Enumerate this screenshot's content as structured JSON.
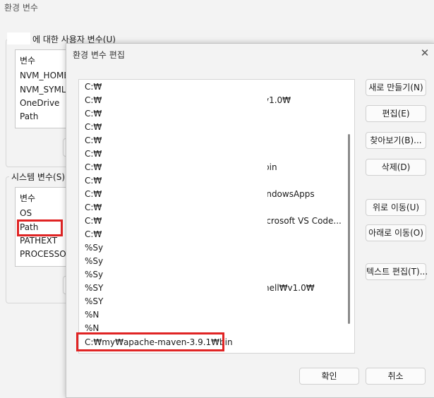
{
  "background_window": {
    "title": "환경 변수",
    "user_group": {
      "legend": "에 대한 사용자 변수(U)",
      "header": "변수",
      "items": [
        "NVM_HOME",
        "NVM_SYMLINK",
        "OneDrive",
        "Path"
      ]
    },
    "system_group": {
      "legend": "시스템 변수(S)",
      "header": "변수",
      "items": [
        "OS",
        "Path",
        "PATHEXT",
        "PROCESSOR"
      ]
    }
  },
  "dialog": {
    "title": "환경 변수 편집",
    "close_icon": "close-icon",
    "path_entries": [
      {
        "prefix": "C:₩",
        "tail": ""
      },
      {
        "prefix": "C:₩",
        "tail": "v1.0₩"
      },
      {
        "prefix": "C:₩",
        "tail": ""
      },
      {
        "prefix": "C:₩",
        "tail": ""
      },
      {
        "prefix": "C:₩",
        "tail": ""
      },
      {
        "prefix": "C:₩",
        "tail": ""
      },
      {
        "prefix": "C:₩",
        "tail": "pin"
      },
      {
        "prefix": "C:₩",
        "tail": ""
      },
      {
        "prefix": "C:₩",
        "tail": "indowsApps"
      },
      {
        "prefix": "C:₩",
        "tail": ""
      },
      {
        "prefix": "C:₩",
        "tail": "icrosoft VS Code..."
      },
      {
        "prefix": "C:₩",
        "tail": ""
      },
      {
        "prefix": "%Sy",
        "tail": ""
      },
      {
        "prefix": "%Sy",
        "tail": ""
      },
      {
        "prefix": "%Sy",
        "tail": ""
      },
      {
        "prefix": "%SY",
        "tail": "hell₩v1.0₩"
      },
      {
        "prefix": "%SY",
        "tail": ""
      },
      {
        "prefix": "%N",
        "tail": ""
      },
      {
        "prefix": "%N",
        "tail": ""
      }
    ],
    "selected_entry": "C:₩my₩apache-maven-3.9.1₩bin",
    "buttons": {
      "new": "새로 만들기(N)",
      "edit": "편집(E)",
      "browse": "찾아보기(B)...",
      "delete": "삭제(D)",
      "move_up": "위로 이동(U)",
      "move_down": "아래로 이동(O)",
      "edit_text": "텍스트 편집(T)...",
      "ok": "확인",
      "cancel": "취소"
    }
  },
  "colors": {
    "highlight_border": "#e02424",
    "scroll_thumb": "#8a8a8a"
  }
}
